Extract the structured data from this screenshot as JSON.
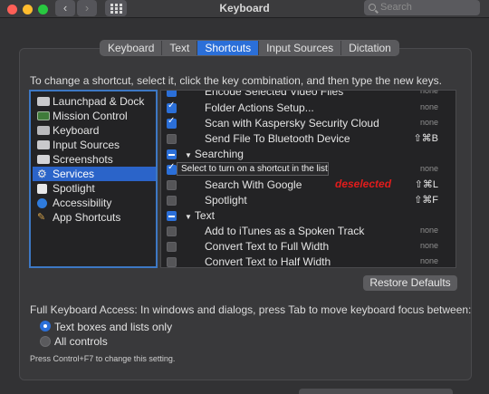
{
  "window": {
    "title": "Keyboard"
  },
  "search": {
    "placeholder": "Search"
  },
  "tabs": [
    {
      "label": "Keyboard",
      "active": false
    },
    {
      "label": "Text",
      "active": false
    },
    {
      "label": "Shortcuts",
      "active": true
    },
    {
      "label": "Input Sources",
      "active": false
    },
    {
      "label": "Dictation",
      "active": false
    }
  ],
  "instructions": "To change a shortcut, select it, click the key combination, and then type the new keys.",
  "categories": [
    {
      "label": "Launchpad & Dock",
      "icon": "launchpad-dock-icon",
      "selected": false
    },
    {
      "label": "Mission Control",
      "icon": "mission-control-icon",
      "selected": false
    },
    {
      "label": "Keyboard",
      "icon": "keyboard-icon",
      "selected": false
    },
    {
      "label": "Input Sources",
      "icon": "input-sources-icon",
      "selected": false
    },
    {
      "label": "Screenshots",
      "icon": "screenshots-icon",
      "selected": false
    },
    {
      "label": "Services",
      "icon": "services-gear-icon",
      "selected": true
    },
    {
      "label": "Spotlight",
      "icon": "spotlight-icon",
      "selected": false
    },
    {
      "label": "Accessibility",
      "icon": "accessibility-icon",
      "selected": false
    },
    {
      "label": "App Shortcuts",
      "icon": "app-shortcuts-icon",
      "selected": false
    }
  ],
  "shortcuts": [
    {
      "label": "Encode Selected Video Files",
      "key": "none",
      "checked": true
    },
    {
      "label": "Folder Actions Setup...",
      "key": "none",
      "checked": true
    },
    {
      "label": "Scan with Kaspersky Security Cloud",
      "key": "none",
      "checked": true
    },
    {
      "label": "Send File To Bluetooth Device",
      "key": "⇧⌘B",
      "checked": false
    },
    {
      "group": "Searching"
    },
    {
      "label": "",
      "key": "none",
      "checked": true
    },
    {
      "label": "Search With Google",
      "key": "⇧⌘L",
      "checked": false
    },
    {
      "label": "Spotlight",
      "key": "⇧⌘F",
      "checked": false
    },
    {
      "group": "Text"
    },
    {
      "label": "Add to iTunes as a Spoken Track",
      "key": "none",
      "checked": false
    },
    {
      "label": "Convert Text to Full Width",
      "key": "none",
      "checked": false
    },
    {
      "label": "Convert Text to Half Width",
      "key": "none",
      "checked": false
    }
  ],
  "tooltip": "Select to turn on a shortcut in the list",
  "annotation": "deselected",
  "restore_label": "Restore Defaults",
  "full_keyboard_access": "Full Keyboard Access: In windows and dialogs, press Tab to move keyboard focus between:",
  "radio_options": [
    {
      "label": "Text boxes and lists only",
      "selected": true
    },
    {
      "label": "All controls",
      "selected": false
    }
  ],
  "hint": "Press Control+F7 to change this setting.",
  "colors": {
    "accent": "#2b6fd8",
    "annotation": "#e21c1c"
  }
}
